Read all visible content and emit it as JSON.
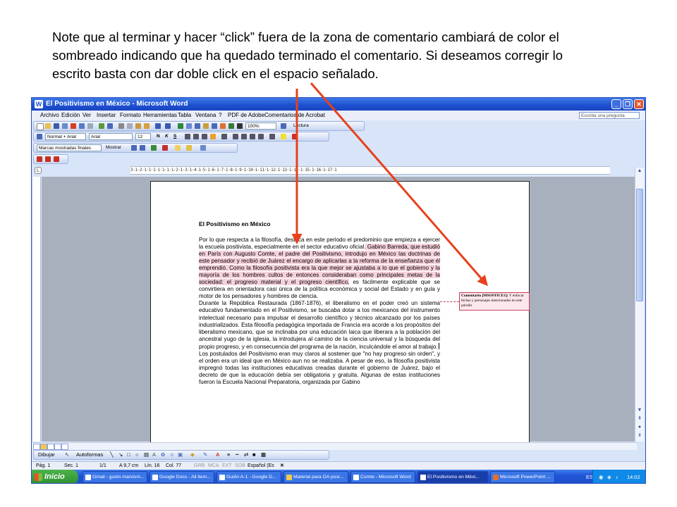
{
  "note_text": "Note que al terminar y hacer “click” fuera de la zona de comentario cambiará de color el sombreado indicando que ha quedado terminado el comentario. Si deseamos corregir lo escrito basta con dar doble click en el espacio señalado.",
  "window": {
    "title": "El Positivismo en México - Microsoft Word",
    "menu": [
      "Archivo",
      "Edición",
      "Ver",
      "Insertar",
      "Formato",
      "Herramientas",
      "Tabla",
      "Ventana",
      "?",
      "PDF de Adobe",
      "Comentarios de Acrobat"
    ],
    "ask_placeholder": "Escriba una pregunta",
    "zoom": "100%",
    "read_button": "Lectura",
    "style_combo": "Normal + Arial",
    "font_combo": "Arial",
    "size_combo": "12",
    "markup_combo": "Marcas mostradas finales",
    "show_button": "Mostrar",
    "ruler_text": "3·1·2·1·1·1·1·1·1·1·2·1·3·1·4·1·5·1·6·1·7·1·8·1·9·1·10·1·11·1·12·1·13·1·14·1·15·1·16·1·17·1"
  },
  "document": {
    "title": "El Positivismo en México",
    "p1_a": "Por lo que respecta  a la filosofía, destaca en este periodo el predominio que empieza a ejercer la escuela positivista, especialmente en el sector educativo oficial.",
    "p1_hl": " Gabino Barreda, que estudió en París con  Augusto Comte, el padre del Positivismo, introdujo en México las doctrinas de este pensador  y recibió de Juárez el encargo   de  aplicarlas a la reforma de la enseñanza que él emprendió.  Como la filosofía positivista era la que mejor se ajustaba a lo que el gobierno y la mayoría de los hombres cultos de entonces consideraban como principales metas de la sociedad: el progreso material y el progreso científico,",
    "p1_b": " es fácilmente explicable que se convirtiera en orientadora casi única de la política económica y social del Estado y en guía y motor de los pensadores y hombres  de ciencia.",
    "p2": "Durante la República Restaurada (1867-1876), el liberalismo en el poder  creó un sistema educativo fundamentado en el Positivismo, se buscaba dotar a los mexicanos del instrumento intelectual necesario para impulsar el desarrollo científico y técnico alcanzado por los países industrializados. Esta filosofía pedagógica importada de Francia  era acorde a los propósitos del liberalismo mexicano, que se inclinaba por una educación laica que liberara a la población del ancestral yugo de la iglesia, la introdujera al camino de la ciencia universal y la búsqueda del propio progreso, y en consecuencia del programa de la nación, inculcándole el amor al trabajo.",
    "p3": " Los postulados del Positivismo eran muy claros al sostener que \"no hay progreso sin orden\", y el orden era un ideal que en México aun no se realizaba.  A  pesar de eso, la filosofía positivista impregnó todas las instituciones educativas creadas durante el gobierno de Juárez, bajo el decreto de que la educación debía ser obligatoria y gratuita.  Algunas de estas instituciones fueron la Escuela Nacional Preparatoria, organizada por Gabino"
  },
  "comment": {
    "label": "Comentario [MSOFFICE1]:",
    "text": "Y enfocar fechas y personajes mencionados en este párrafo"
  },
  "drawbar": {
    "draw": "Dibujar",
    "autoshapes": "Autoformas"
  },
  "status": {
    "page": "Pág. 1",
    "section": "Sec. 1",
    "pages": "1/1",
    "at": "A 9,7 cm",
    "line": "Lín. 16",
    "col": "Col. 77",
    "modes": [
      "GRB",
      "MCA",
      "EXT",
      "SOB"
    ],
    "lang": "Español (Es"
  },
  "taskbar": {
    "start": "Inicio",
    "tasks": [
      "Gmail - guión marxism...",
      "Google Docs - All item...",
      "Guión A-1 - Google D...",
      "Material para OA posi...",
      "Comte - Microsoft Word",
      "El Positivismo en Méxi...",
      "Microsoft PowerPoint ..."
    ],
    "lang": "ES",
    "clock": "14:02"
  },
  "colors": {
    "arrow": "#e8401c",
    "highlight": "#f6d2dc",
    "comment_border": "#c4405a"
  }
}
